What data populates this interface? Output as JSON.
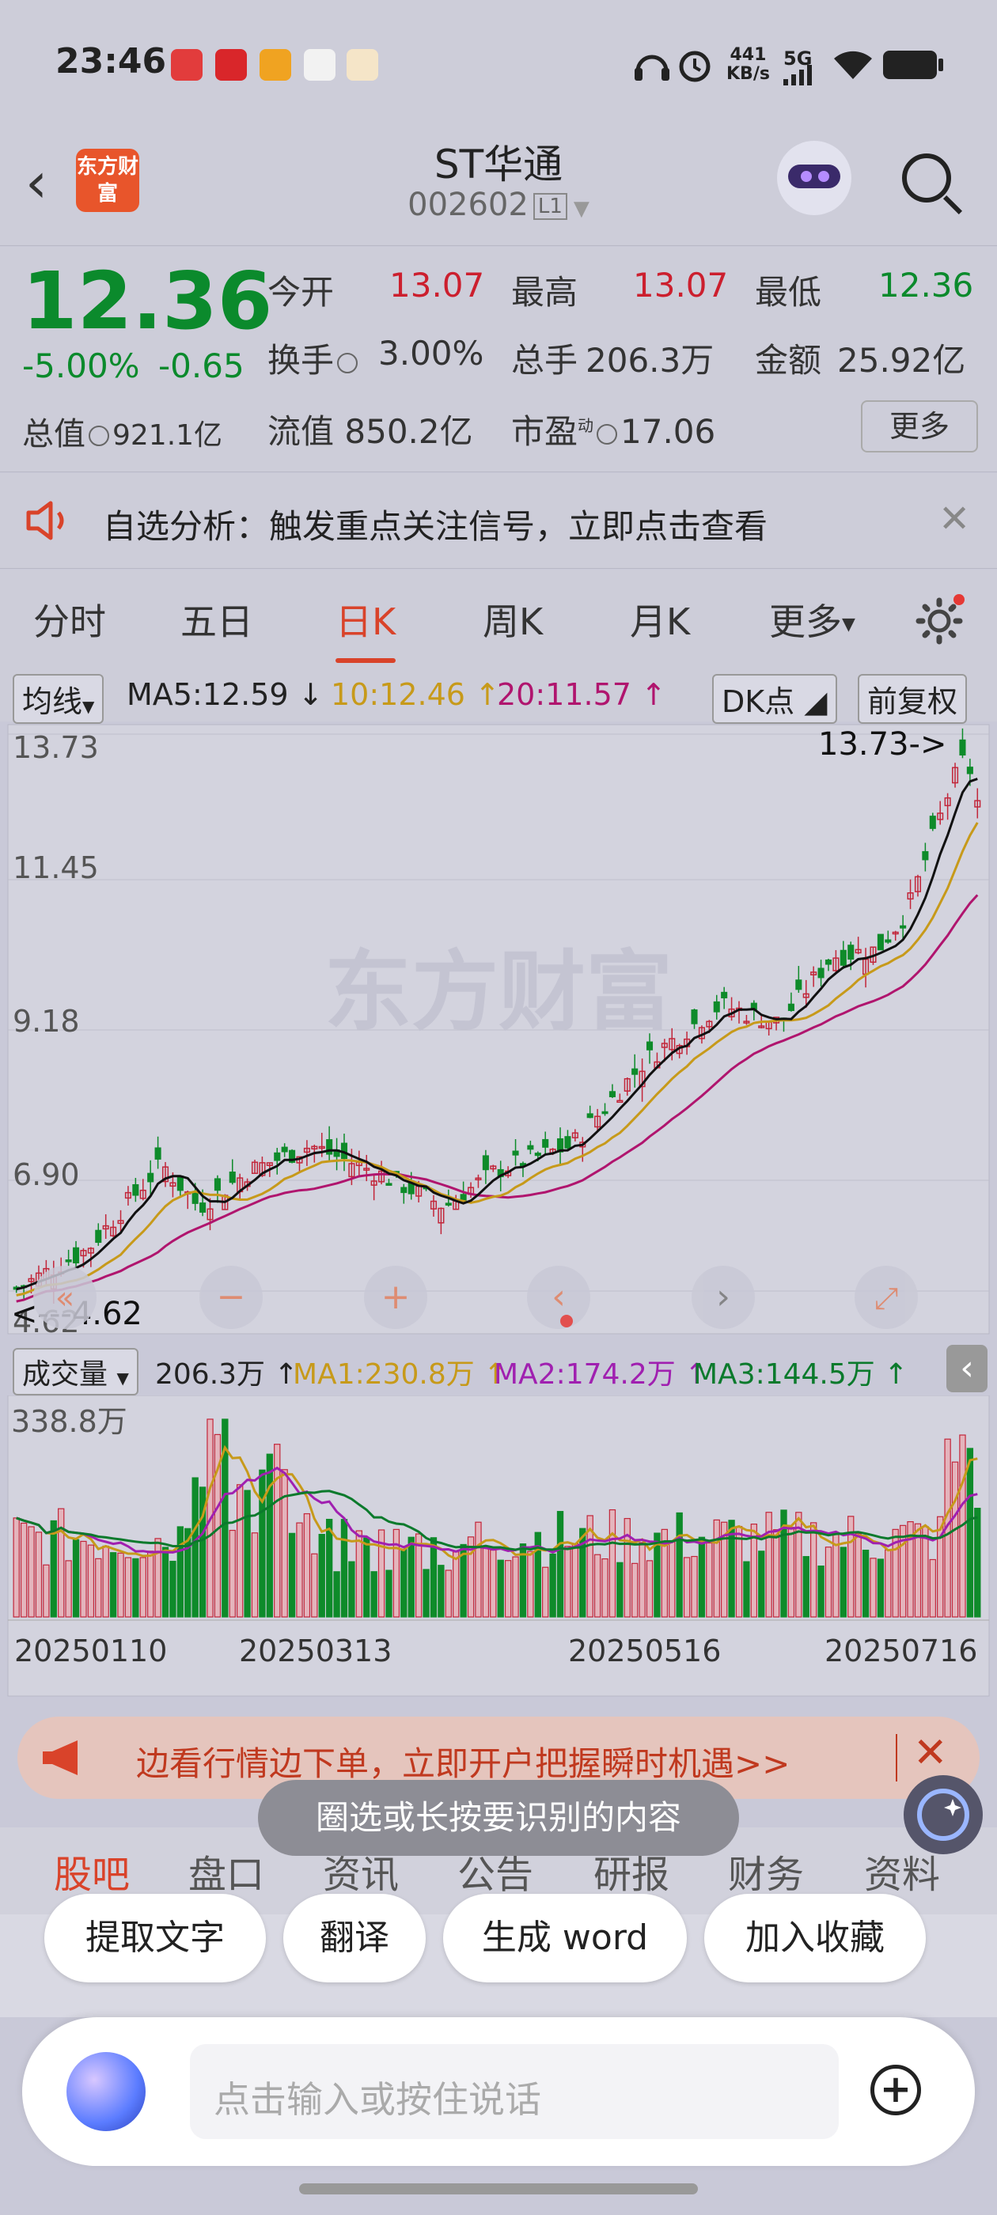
{
  "status_bar": {
    "time": "23:46",
    "net_speed_value": "441",
    "net_speed_unit": "KB/s",
    "network": "5G"
  },
  "header": {
    "logo_text": "东方财富",
    "title": "ST华通",
    "code": "002602",
    "level": "L1"
  },
  "quote": {
    "price": "12.36",
    "change_pct": "-5.00%",
    "change_amt": "-0.65",
    "open_label": "今开",
    "open_value": "13.07",
    "high_label": "最高",
    "high_value": "13.07",
    "low_label": "最低",
    "low_value": "12.36",
    "turnover_label": "换手",
    "turnover_value": "3.00%",
    "volume_label": "总手",
    "volume_value": "206.3万",
    "amount_label": "金额",
    "amount_value": "25.92亿",
    "mktcap_label": "总值",
    "mktcap_value": "921.1亿",
    "float_label": "流值",
    "float_value": "850.2亿",
    "pe_label": "市盈",
    "pe_sup": "动",
    "pe_value": "17.06",
    "more_label": "更多"
  },
  "alert": {
    "text": "自选分析：触发重点关注信号，立即点击查看"
  },
  "period_tabs": [
    "分时",
    "五日",
    "日K",
    "周K",
    "月K",
    "更多"
  ],
  "ma_bar": {
    "selector": "均线",
    "ma5": "MA5:12.59",
    "ma10": "10:12.46",
    "ma20": "20:11.57",
    "dk": "DK点",
    "adjust": "前复权",
    "colors": {
      "ma5": "#222222",
      "ma10": "#c79a1a",
      "ma20": "#b0156e"
    }
  },
  "kline": {
    "y_labels": [
      "13.73",
      "11.45",
      "9.18",
      "6.90"
    ],
    "y_label_bottom": "4.62",
    "high_marker": "13.73->",
    "low_marker": "<---4.62",
    "watermark": "东方财富"
  },
  "volume_bar": {
    "selector": "成交量",
    "vol": "206.3万",
    "ma1": "MA1:230.8万",
    "ma2": "MA2:174.2万",
    "ma3": "MA3:144.5万",
    "max_label": "338.8万",
    "colors": {
      "ma1": "#c79a1a",
      "ma2": "#a020b0",
      "ma3": "#0b7a2c"
    }
  },
  "x_dates": [
    "20250110",
    "20250313",
    "20250516",
    "20250716"
  ],
  "banner": {
    "text": "边看行情边下单，立即开户把握瞬时机遇>>"
  },
  "tooltip": {
    "text": "圈选或长按要识别的内容"
  },
  "sub_tabs": [
    "股吧",
    "盘口",
    "资讯",
    "公告",
    "研报",
    "财务",
    "资料"
  ],
  "actions": [
    "提取文字",
    "翻译",
    "生成 word",
    "加入收藏"
  ],
  "input": {
    "placeholder": "点击输入或按住说话"
  }
}
